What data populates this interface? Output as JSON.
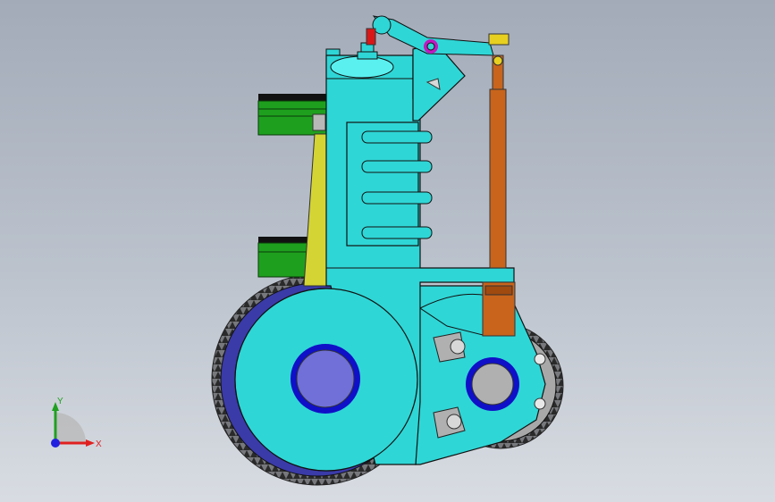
{
  "viewport": {
    "background_top": "#a3abb9",
    "background_bottom": "#d8dce2"
  },
  "model": {
    "parts": [
      "engine-block",
      "cylinder-fins",
      "top-flange",
      "rocker-bracket",
      "rocker-arm",
      "push-rod",
      "push-rod-tube",
      "upper-piston",
      "lower-piston",
      "connecting-rod",
      "large-gear",
      "small-gear",
      "lower-bracket",
      "valve-spring",
      "adjuster-screw"
    ],
    "colors": {
      "block": "#2fd6d6",
      "block_edge": "#0b1a1a",
      "piston": "#1ea01e",
      "piston_top": "#111111",
      "rod": "#d4d434",
      "push_rod": "#c8641c",
      "gear": "#3a3aa8",
      "gear_face": "#7070d8",
      "gear_teeth": "#6c6c70",
      "hub_ring": "#1010c8",
      "hub_gray": "#b0b0b0",
      "accent_magenta": "#c018c0",
      "accent_red": "#d81818",
      "accent_yellow": "#e8d020"
    }
  },
  "triad": {
    "x_label": "X",
    "y_label": "Y",
    "x_color": "#e02020",
    "y_color": "#20a020",
    "z_color": "#2020e0"
  }
}
